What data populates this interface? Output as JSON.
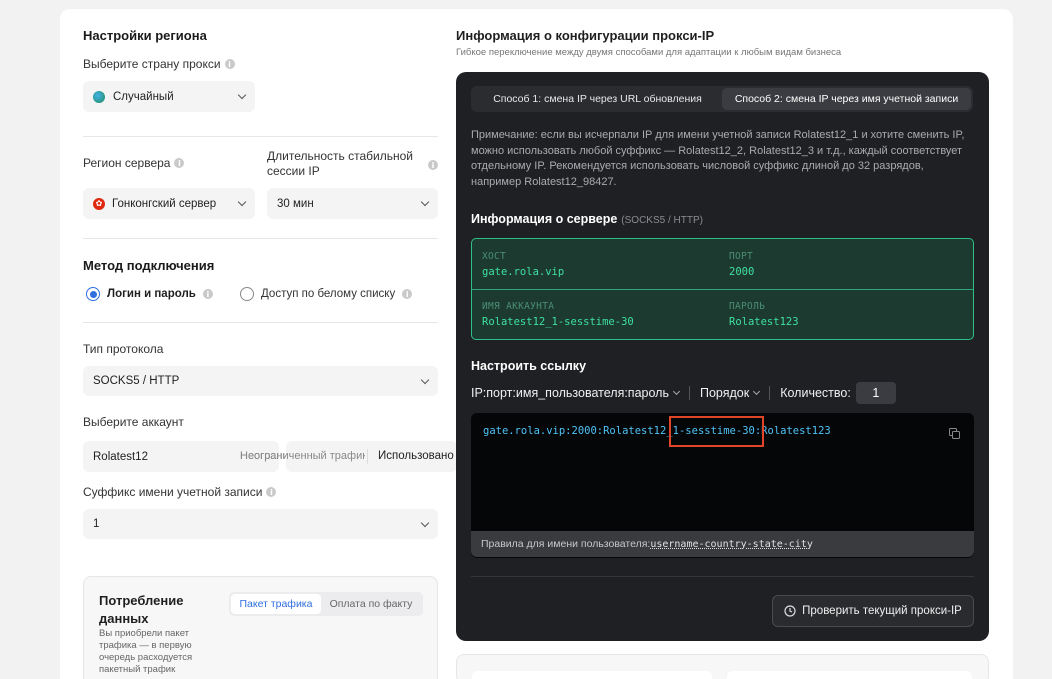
{
  "region": {
    "title": "Настройки региона",
    "country_label": "Выберите страну прокси",
    "country_value": "Случайный",
    "server_region_label": "Регион сервера",
    "server_region_value": "Гонконгский сервер",
    "session_label_1": "Длительность стабильной",
    "session_label_2": "сессии IP",
    "session_value": "30 мин"
  },
  "connection": {
    "title": "Метод подключения",
    "option_login": "Логин и пароль",
    "option_whitelist": "Доступ по белому списку",
    "protocol_label": "Тип протокола",
    "protocol_value": "SOCKS5 / HTTP",
    "account_label": "Выберите аккаунт",
    "account_value": "Rolatest12",
    "traffic_text": "Неограниченный трафик",
    "used_text": "Использовано",
    "suffix_label": "Суффикс имени учетной записи",
    "suffix_value": "1"
  },
  "consumption": {
    "title_1": "Потребление",
    "title_2": "данных",
    "tab_package": "Пакет трафика",
    "tab_payg": "Оплата по факту",
    "desc_1": "Вы приобрели пакет",
    "desc_2": "трафика — в первую",
    "desc_3": "очередь расходуется",
    "desc_4": "пакетный трафик"
  },
  "proxy_info": {
    "title": "Информация о конфигурации прокси-IP",
    "subtitle": "Гибкое переключение между двумя способами для адаптации к любым видам бизнеса",
    "tab_1": "Способ 1: смена IP через URL обновления",
    "tab_2": "Способ 2: смена IP через имя учетной записи",
    "note": "Примечание: если вы исчерпали IP для имени учетной записи Rolatest12_1 и хотите сменить IP, можно использовать любой суффикс — Rolatest12_2, Rolatest12_3 и т.д., каждый соответствует отдельному IP. Рекомендуется использовать числовой суффикс длиной до 32 разрядов, например Rolatest12_98427."
  },
  "server": {
    "title": "Информация о сервере",
    "protocols": "(SOCKS5 / HTTP)",
    "host_key": "ХОСТ",
    "host_value": "gate.rola.vip",
    "port_key": "ПОРТ",
    "port_value": "2000",
    "account_key": "ИМЯ АККАУНТА",
    "account_value": "Rolatest12_1-sesstime-30",
    "password_key": "ПАРОЛЬ",
    "password_value": "Rolatest123"
  },
  "link": {
    "title": "Настроить ссылку",
    "format": "IP:порт:имя_пользователя:пароль",
    "order": "Порядок",
    "quantity_label": "Количество:",
    "quantity_value": "1",
    "code_part_1": "gate.rola.vip:2000:Rolatest12_",
    "code_part_2": "1-sesstime-30:",
    "code_part_3": "Rolatest123",
    "rules_label": "Правила для имени пользователя:",
    "rules_value": "username-country-state-city",
    "check_button": "Проверить текущий прокси-IP"
  },
  "colors": {
    "accent_blue": "#2f6fe0",
    "green_border": "#2fc08a",
    "highlight_box": "#e0452a"
  }
}
